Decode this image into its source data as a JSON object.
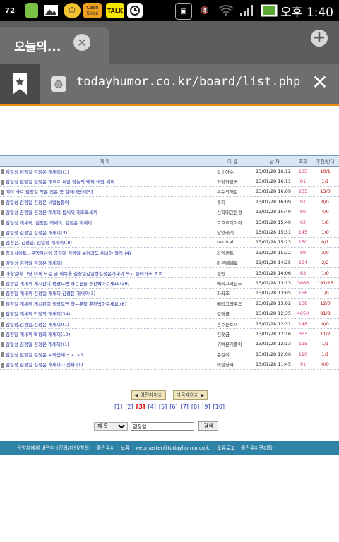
{
  "status_bar": {
    "time": "오후 1:40",
    "icons": [
      "clock-badge-icon",
      "usb-icon",
      "gallery-icon",
      "emoji-icon",
      "cashslide-icon",
      "talk-icon",
      "clock-icon",
      "game-icon",
      "mute-icon",
      "wifi-icon",
      "signal-icon",
      "battery-icon"
    ],
    "badge_text": "72",
    "cashslide_label": "Cash Slide",
    "talk_label": "TALK"
  },
  "tab": {
    "title": "오늘의..."
  },
  "url_bar": {
    "url": "todayhumor.co.kr/board/list.php?ta"
  },
  "board": {
    "headers": [
      "제 목",
      "이 름",
      "날 짜",
      "조회",
      "추천/반대"
    ],
    "rows": [
      {
        "title": "김일성 김정일 김정은 개새끼!(1)",
        "name": "갓ㅣ아수",
        "date": "13/01/28 16:12",
        "views": "135",
        "rec": "10/1"
      },
      {
        "title": "김일성 김정일 김정은 개호로 씨발 잣놀의 돼지 비만 새끼",
        "name": "파닭파닭귀",
        "date": "13/01/28 16:11",
        "views": "81",
        "rec": "1/1"
      },
      {
        "title": "에이 바로 김정일 죽은 것은 못 알아내면서[5]",
        "name": "복수의해갈",
        "date": "13/01/28 16:09",
        "views": "235",
        "rec": "13/0"
      },
      {
        "title": "김일성 김정일 김정은 씨발놈들아",
        "name": "류지",
        "date": "13/01/28 16:09",
        "views": "91",
        "rec": "0/0"
      },
      {
        "title": "김일성 김정일 김정은 개새끼 씹새끼 개호로새끼",
        "name": "신학대민원원",
        "date": "13/01/28 15:49",
        "views": "80",
        "rec": "4/0"
      },
      {
        "title": "김일성 개새끼, 김정일 개새끼, 김정은 개새끼",
        "name": "호호호이이이",
        "date": "13/01/28 15:40",
        "views": "62",
        "rec": "1/0"
      },
      {
        "title": "김일성 김정일 김정은 개새끼(3)",
        "name": "남았래레",
        "date": "13/01/28 15:31",
        "views": "145",
        "rec": "1/0"
      },
      {
        "title": "김정은, 김정일, 김일성 개새끼!(8)",
        "name": "neutral",
        "date": "13/01/28 15:23",
        "views": "150",
        "rec": "0/1"
      },
      {
        "title": "종북사이트.. 운영자님이 공지에 김정일 욕이라도 써놔야 할거 (4)",
        "name": "라임샌트",
        "date": "13/01/28 15:22",
        "views": "89",
        "rec": "3/0"
      },
      {
        "title": "김일성 김정일 김정은 개새끼!",
        "name": "마른빼빼로",
        "date": "13/01/28 14:25",
        "views": "194",
        "rec": "2/2"
      },
      {
        "title": "아침일에 그냥 이제 모든 글 제목을 김정일김일성김정은개새끼 쓰고 들어가죠 ㅎㅎ",
        "name": "설빈",
        "date": "13/01/28 14:06",
        "views": "83",
        "rec": "1/0"
      },
      {
        "title": "김정일 개새끼 게시판이 생겼으면 하는분들 추천박아주세요.(39)",
        "name": "메리고라운드",
        "date": "13/01/28 13:13",
        "views": "3666",
        "rec": "191/26"
      },
      {
        "title": "김정일 개새끼 김정일 개새끼 김정은 개새끼(3)",
        "name": "파라조",
        "date": "13/01/28 13:05",
        "views": "156",
        "rec": "1/0"
      },
      {
        "title": "김정일 개새끼 게시판이 생겼으면 하는분들 추천박아주세요.(6)",
        "name": "메리고라운드",
        "date": "13/01/28 13:02",
        "views": "138",
        "rec": "12/0"
      },
      {
        "title": "김정일 개새끼 박정희 개새끼(34)",
        "name": "김젖금",
        "date": "13/01/28 12:35",
        "views": "4050",
        "rec": "81/8"
      },
      {
        "title": "김일성,김정일,김정은 개새끼!(1)",
        "name": "혼주눈토끼",
        "date": "13/01/28 12:31",
        "views": "148",
        "rec": "0/0"
      },
      {
        "title": "김정일 개새끼 박정희 개새끼(10)",
        "name": "김젖금",
        "date": "13/01/28 12:16",
        "views": "363",
        "rec": "11/2"
      },
      {
        "title": "김일성 김정일 김정은 개새끼!(1)",
        "name": "귀여운거좋아",
        "date": "13/01/28 12:13",
        "views": "115",
        "rec": "1/1"
      },
      {
        "title": "김일성 김정일 김정은 ㅅ끼씹새ㄹ ㅅ ㅅ1",
        "name": "준일이",
        "date": "13/01/28 12:06",
        "views": "110",
        "rec": "1/1"
      },
      {
        "title": "김일성 김정일 김정은 개새끼다 진짜.(1)",
        "name": "비밀냥자",
        "date": "13/01/28 11:45",
        "views": "91",
        "rec": "0/0"
      }
    ]
  },
  "pager": {
    "prev_label": "◀ 이전페이지",
    "next_label": "다음페이지 ▶",
    "pages": [
      "[1]",
      "[2]",
      "[3]",
      "[4]",
      "[5]",
      "[6]",
      "[7]",
      "[8]",
      "[9]",
      "[10]"
    ],
    "current_index": 2
  },
  "search": {
    "field_label": "제 목",
    "query": "김정일",
    "button_label": "검색"
  },
  "footer": {
    "items": [
      "운영자에게 바란다 (건의/제안/항의)",
      "클린유저",
      "보류",
      "webmaster@todayhumor.co.kr",
      "오유로고",
      "클린유저관리툴"
    ]
  }
}
